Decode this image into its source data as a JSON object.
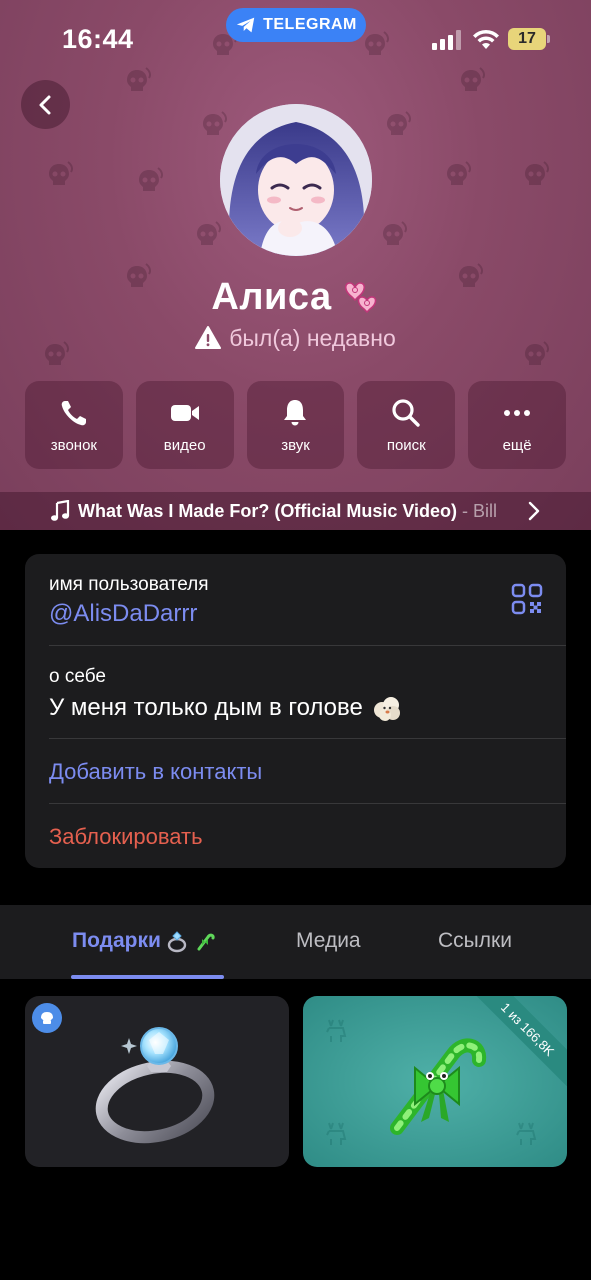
{
  "status_bar": {
    "time": "16:44",
    "app_pill": "TELEGRAM",
    "battery": "17"
  },
  "profile": {
    "name": "Алиса",
    "status": "был(а) недавно"
  },
  "actions": [
    {
      "label": "звонок",
      "icon": "phone-icon"
    },
    {
      "label": "видео",
      "icon": "video-camera-icon"
    },
    {
      "label": "звук",
      "icon": "bell-icon"
    },
    {
      "label": "поиск",
      "icon": "search-icon"
    },
    {
      "label": "ещё",
      "icon": "more-dots-icon"
    }
  ],
  "music": {
    "title": "What Was I Made For? (Official Music Video)",
    "artist": " - Bill"
  },
  "info": {
    "username_label": "имя пользователя",
    "username": "@AlisDaDarrr",
    "bio_label": "о себе",
    "bio": "У меня только дым в голове",
    "add_contact": "Добавить в контакты",
    "block": "Заблокировать"
  },
  "tabs": {
    "gifts": "Подарки",
    "media": "Медиа",
    "links": "Ссылки"
  },
  "gifts": [
    {
      "name": "diamond-ring",
      "badge": "verified"
    },
    {
      "name": "candy-cane",
      "ribbon": "1 из 166,8K"
    }
  ],
  "colors": {
    "header_bg": "#8a4a68",
    "accent": "#7c8cf0",
    "danger": "#e5604f",
    "card_bg": "#1c1c1e"
  }
}
